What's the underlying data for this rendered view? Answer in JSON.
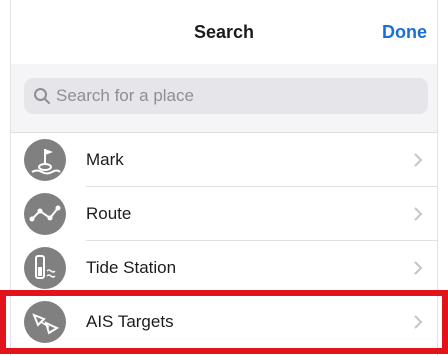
{
  "nav": {
    "title": "Search",
    "done_label": "Done"
  },
  "search": {
    "placeholder": "Search for a place",
    "value": ""
  },
  "rows": [
    {
      "label": "Mark",
      "icon": "flag-marker-icon"
    },
    {
      "label": "Route",
      "icon": "route-icon"
    },
    {
      "label": "Tide Station",
      "icon": "tide-station-icon"
    },
    {
      "label": "AIS Targets",
      "icon": "ais-target-icon"
    }
  ],
  "colors": {
    "accent": "#1a6fd6",
    "highlight": "#e3131b",
    "icon_bg": "#808080"
  }
}
